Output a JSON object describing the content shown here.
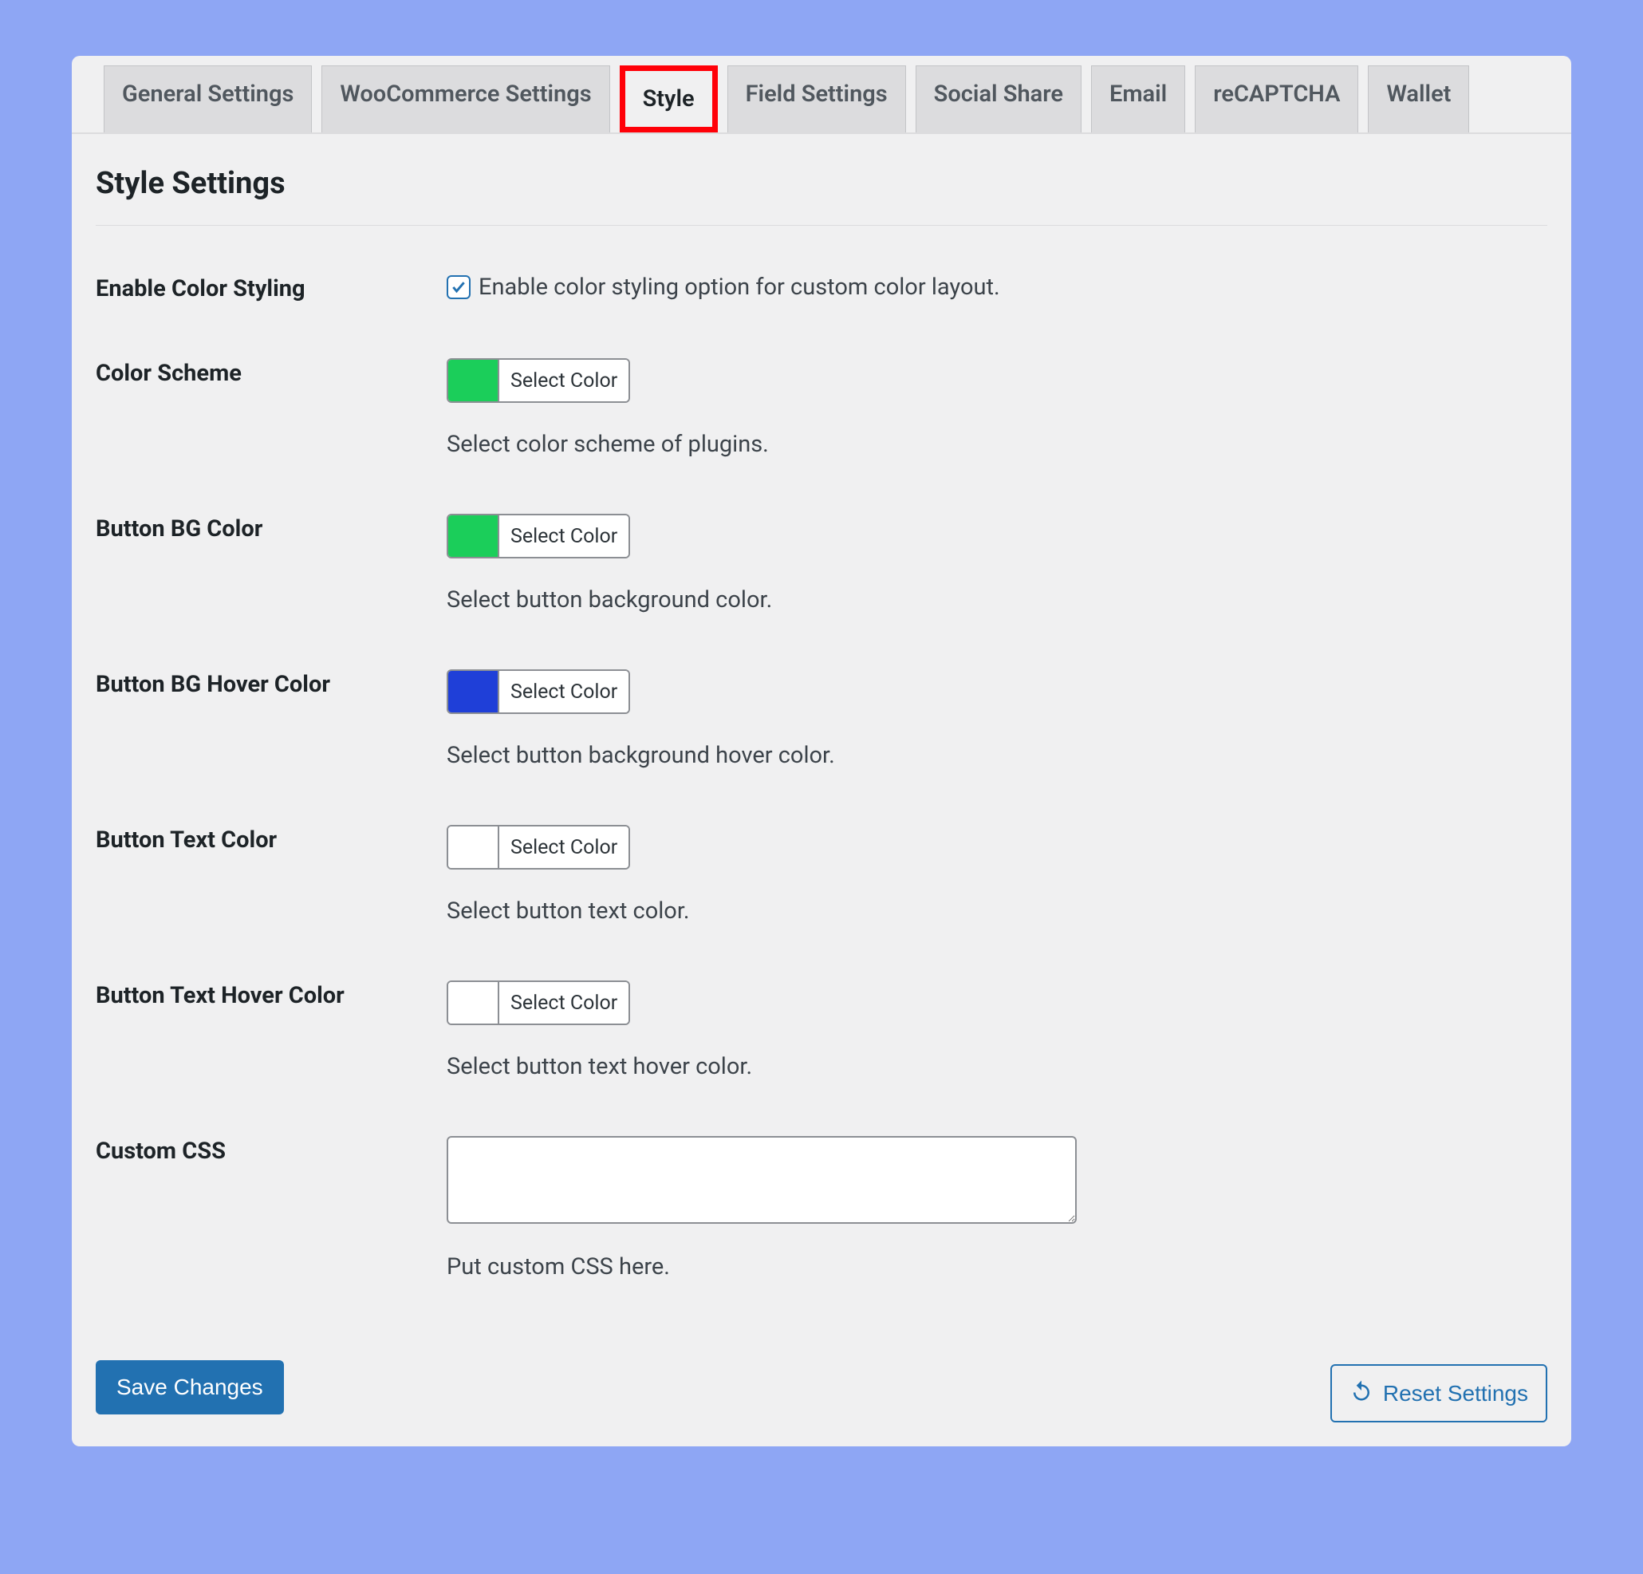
{
  "tabs": [
    {
      "label": "General Settings",
      "active": false
    },
    {
      "label": "WooCommerce Settings",
      "active": false
    },
    {
      "label": "Style",
      "active": true
    },
    {
      "label": "Field Settings",
      "active": false
    },
    {
      "label": "Social Share",
      "active": false
    },
    {
      "label": "Email",
      "active": false
    },
    {
      "label": "reCAPTCHA",
      "active": false
    },
    {
      "label": "Wallet",
      "active": false
    }
  ],
  "page_title": "Style Settings",
  "rows": {
    "enable_styling": {
      "label": "Enable Color Styling",
      "checkbox_text": "Enable color styling option for custom color layout.",
      "checked": true
    },
    "color_scheme": {
      "label": "Color Scheme",
      "swatch": "#1bce5a",
      "btn": "Select Color",
      "desc": "Select color scheme of plugins."
    },
    "btn_bg": {
      "label": "Button BG Color",
      "swatch": "#1bce5a",
      "btn": "Select Color",
      "desc": "Select button background color."
    },
    "btn_bg_hover": {
      "label": "Button BG Hover Color",
      "swatch": "#1f3fd8",
      "btn": "Select Color",
      "desc": "Select button background hover color."
    },
    "btn_text": {
      "label": "Button Text Color",
      "swatch": "#ffffff",
      "btn": "Select Color",
      "desc": "Select button text color."
    },
    "btn_text_hover": {
      "label": "Button Text Hover Color",
      "swatch": "#ffffff",
      "btn": "Select Color",
      "desc": "Select button text hover color."
    },
    "custom_css": {
      "label": "Custom CSS",
      "value": "",
      "desc": "Put custom CSS here."
    }
  },
  "save_label": "Save Changes",
  "reset_label": "Reset Settings"
}
